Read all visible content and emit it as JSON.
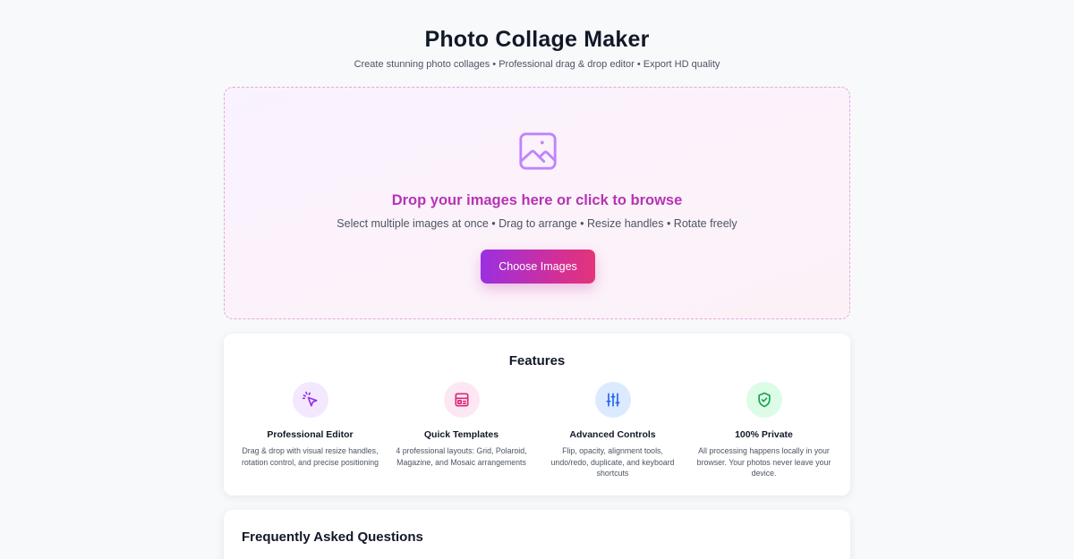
{
  "header": {
    "title": "Photo Collage Maker",
    "subtitle": "Create stunning photo collages • Professional drag & drop editor • Export HD quality"
  },
  "upload": {
    "icon": "image-icon",
    "title": "Drop your images here or click to browse",
    "subtitle": "Select multiple images at once • Drag to arrange • Resize handles • Rotate freely",
    "button_label": "Choose Images"
  },
  "features": {
    "title": "Features",
    "items": [
      {
        "icon": "cursor-click-icon",
        "title": "Professional Editor",
        "description": "Drag & drop with visual resize handles, rotation control, and precise positioning",
        "icon_color": "#9333ea",
        "icon_bg": "#f3e8ff"
      },
      {
        "icon": "layout-template-icon",
        "title": "Quick Templates",
        "description": "4 professional layouts: Grid, Polaroid, Magazine, and Mosaic arrangements",
        "icon_color": "#db2777",
        "icon_bg": "#fce7f3"
      },
      {
        "icon": "sliders-icon",
        "title": "Advanced Controls",
        "description": "Flip, opacity, alignment tools, undo/redo, duplicate, and keyboard shortcuts",
        "icon_color": "#2563eb",
        "icon_bg": "#dbeafe"
      },
      {
        "icon": "shield-check-icon",
        "title": "100% Private",
        "description": "All processing happens locally in your browser. Your photos never leave your device.",
        "icon_color": "#16a34a",
        "icon_bg": "#dcfce7"
      }
    ]
  },
  "faq": {
    "title": "Frequently Asked Questions"
  },
  "colors": {
    "accent_purple": "#9b2fe0",
    "accent_pink": "#e2357a",
    "drop_title": "#b634b3"
  }
}
